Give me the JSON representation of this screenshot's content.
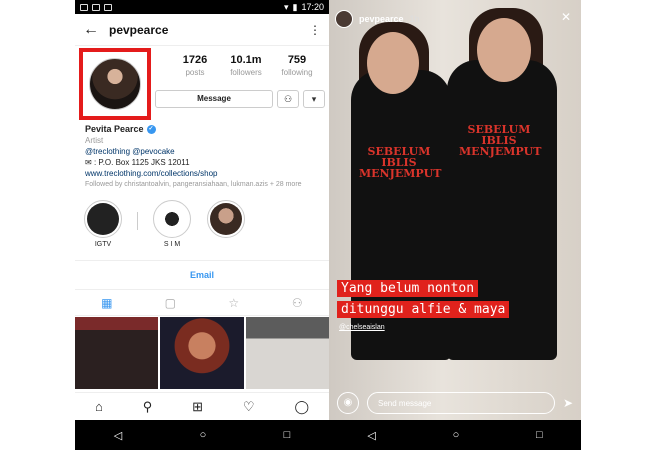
{
  "status_bar": {
    "time": "17:20"
  },
  "profile": {
    "username": "pevpearce",
    "stats": [
      {
        "num": "1726",
        "label": "posts"
      },
      {
        "num": "10.1m",
        "label": "followers"
      },
      {
        "num": "759",
        "label": "following"
      }
    ],
    "message_label": "Message",
    "follow_icon": "add-person-icon",
    "dropdown_icon": "chevron-down-icon",
    "name": "Pevita Pearce",
    "category": "Artist",
    "bio_line1": "@treclothing @pevocake",
    "bio_line2": ": P.O. Box 1125 JKS 12011",
    "website": "www.treclothing.com/collections/shop",
    "followed_by": "Followed by christantoalvin, pangeransiahaan, lukman.azis + 28 more",
    "highlights": [
      {
        "label": "IGTV"
      },
      {
        "label": "S I M"
      },
      {
        "label": ""
      }
    ],
    "email_label": "Email",
    "accent_color": "#3897f0",
    "highlight_border_color": "#e41b1b"
  },
  "story": {
    "username": "pevpearce",
    "time": "1h",
    "caption_line1": "Yang belum nonton",
    "caption_line2": "ditunggu alfie & maya",
    "mention": "@chelseaislan",
    "shirt_text": "SEBELUM IBLIS MENJEMPUT",
    "send_placeholder": "Send message",
    "caption_bg_color": "#e0221c"
  }
}
